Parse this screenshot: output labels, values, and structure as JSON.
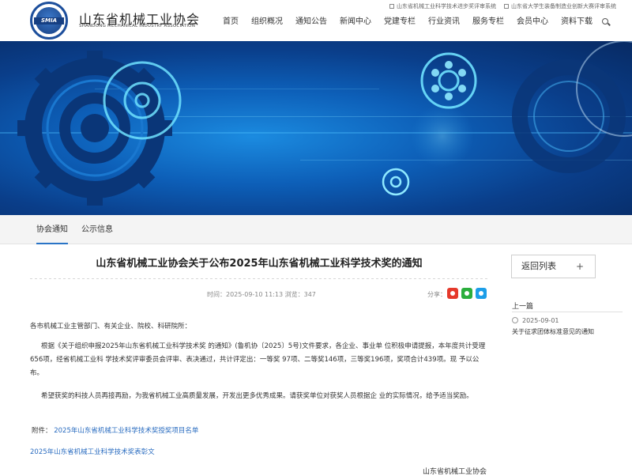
{
  "header": {
    "logo_seal_text": "SMIA",
    "site_title": "山东省机械工业协会",
    "site_subtitle": "SHANDONG MECHANICAL INDUSTRY ASSOCIATION",
    "top_links": [
      "山东省机械工业科学技术进步奖评审系统",
      "山东省大学生装备制造业创新大赛评审系统"
    ],
    "nav": [
      "首页",
      "组织概况",
      "通知公告",
      "新闻中心",
      "党建专栏",
      "行业资讯",
      "服务专栏",
      "会员中心",
      "资料下载"
    ]
  },
  "subnav": {
    "tabs": [
      "协会通知",
      "公示信息"
    ],
    "active": "协会通知"
  },
  "article": {
    "title": "山东省机械工业协会关于公布2025年山东省机械工业科学技术奖的通知",
    "meta": "时间：2025-09-10 11:13   浏览：347",
    "share_label": "分享：",
    "greeting": "各市机械工业主管部门、有关企业、院校、科研院所：",
    "para1": "根据《关于组织申报2025年山东省机械工业科学技术奖 的通知》(鲁机协〔2025〕5号)文件要求，各企业、事业单 位积极申请提报，本年度共计受理656项，经省机械工业科 学技术奖评审委员会评审、表决通过，共计评定出：一等奖 97项、二等奖146项，三等奖196项，奖项合计439项。现 予以公布。",
    "para2": "希望获奖的科技人员再接再励，为我省机械工业高质量发展，开发出更多优秀成果。请获奖单位对获奖人员根据企 业的实际情况，给予适当奖励。",
    "attachment_label": "附件：",
    "attachment_link": "2025年山东省机械工业科学技术奖授奖项目名单",
    "link2": "2025年山东省机械工业科学技术奖表彰文",
    "signature": "山东省机械工业协会"
  },
  "sidebar": {
    "back_label": "返回列表",
    "back_plus": "+",
    "prev_heading": "上一篇",
    "prev_date": "2025-09-01",
    "prev_title": "关于征求团体标准意见的通知"
  },
  "colors": {
    "brand_blue": "#1d4f9c",
    "link": "#2a6cc0",
    "banner_bg": "#0d5fb8"
  }
}
